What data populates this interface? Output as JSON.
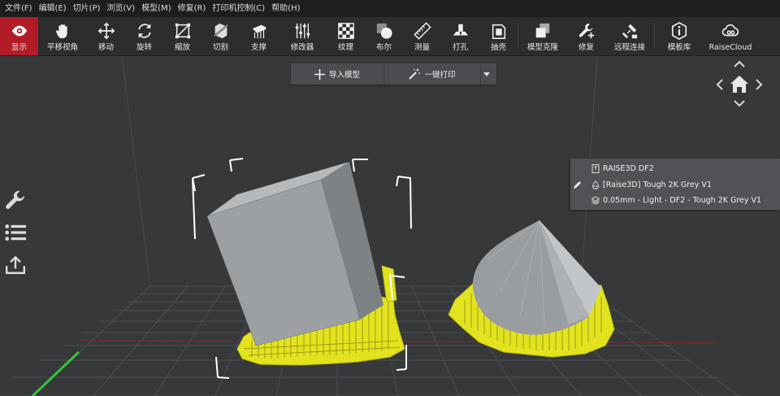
{
  "menubar": {
    "items": [
      "文件(F)",
      "编辑(E)",
      "切片(P)",
      "浏览(V)",
      "模型(M)",
      "修复(R)",
      "打印机控制(C)",
      "帮助(H)"
    ]
  },
  "toolbar": {
    "items": [
      {
        "label": "显示",
        "icon": "eye-icon",
        "active": true
      },
      {
        "label": "平移视角",
        "icon": "hand-icon"
      },
      {
        "label": "移动",
        "icon": "move-arrows-icon"
      },
      {
        "label": "旋转",
        "icon": "rotate-icon"
      },
      {
        "label": "缩放",
        "icon": "scale-icon"
      },
      {
        "label": "切割",
        "icon": "cut-icon"
      },
      {
        "label": "支撑",
        "icon": "support-icon"
      },
      {
        "label": "修改器",
        "icon": "modifier-sliders-icon"
      },
      {
        "label": "纹理",
        "icon": "texture-icon"
      },
      {
        "label": "布尔",
        "icon": "boolean-icon"
      },
      {
        "label": "测量",
        "icon": "ruler-icon"
      },
      {
        "label": "打孔",
        "icon": "punch-hole-icon"
      },
      {
        "label": "抽壳",
        "icon": "hollow-icon"
      },
      {
        "label": "模型克隆",
        "icon": "clone-icon"
      },
      {
        "label": "修复",
        "icon": "wrench-plus-icon"
      },
      {
        "label": "远程连接",
        "icon": "remote-connect-icon"
      },
      {
        "label": "模板库",
        "icon": "template-library-icon"
      },
      {
        "label": "RaiseCloud",
        "icon": "cloud-icon"
      }
    ]
  },
  "actionbar": {
    "import_label": "导入模型",
    "oneclick_label": "一键打印"
  },
  "printer_info": {
    "printer": "RAISE3D DF2",
    "material": "[Raise3D] Tough 2K Grey V1",
    "profile": "0.05mm - Light - DF2 - Tough 2K Grey V1"
  },
  "left_tools": [
    "wrench-icon",
    "list-icon",
    "export-icon"
  ],
  "colors": {
    "menubar_bg": "#1d1e20",
    "toolbar_bg": "#2b2d2f",
    "active_tool": "#b21c27",
    "viewport_bg": "#36383a",
    "model_grey": "#9da0a3",
    "support_yellow": "#e2e31e"
  }
}
